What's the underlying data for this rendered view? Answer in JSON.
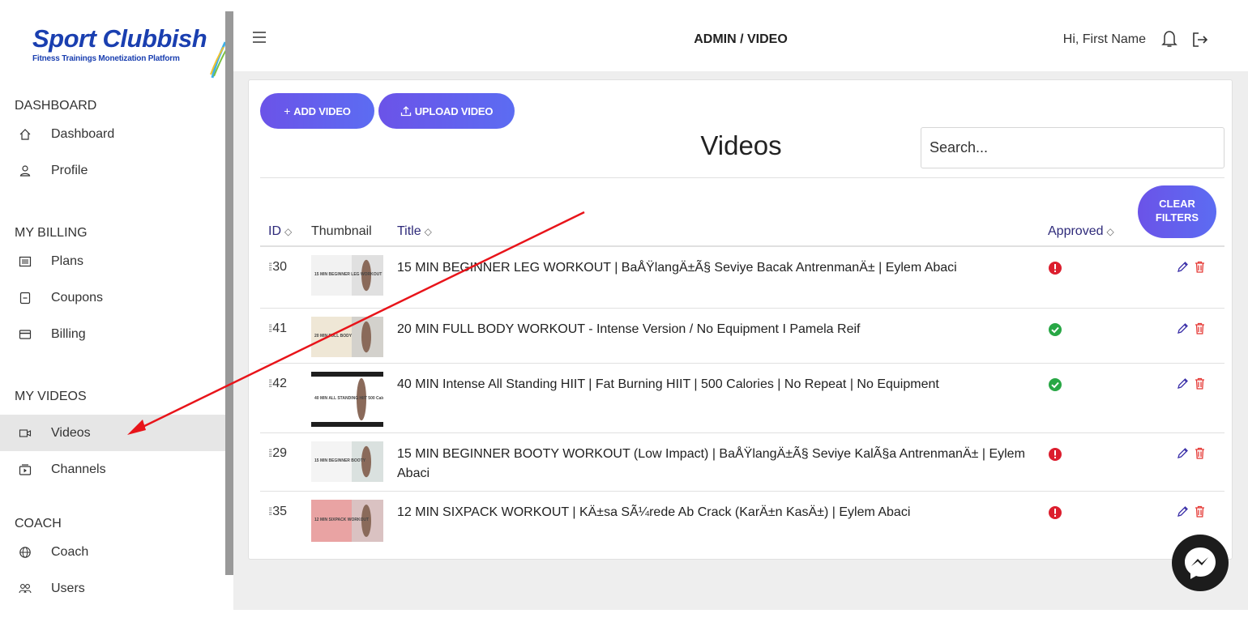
{
  "logo": {
    "title": "Sport Clubbish",
    "subtitle": "Fitness Trainings Monetization Platform"
  },
  "topbar": {
    "path": "ADMIN / VIDEO",
    "greeting": "Hi, First Name"
  },
  "sidebar": {
    "sections": [
      {
        "header": "DASHBOARD",
        "items": [
          {
            "label": "Dashboard",
            "icon": "home-icon"
          },
          {
            "label": "Profile",
            "icon": "user-icon"
          }
        ]
      },
      {
        "header": "MY BILLING",
        "items": [
          {
            "label": "Plans",
            "icon": "list-icon"
          },
          {
            "label": "Coupons",
            "icon": "coupon-icon"
          },
          {
            "label": "Billing",
            "icon": "card-icon"
          }
        ]
      },
      {
        "header": "MY VIDEOS",
        "items": [
          {
            "label": "Videos",
            "icon": "video-icon",
            "active": true
          },
          {
            "label": "Channels",
            "icon": "channel-icon"
          }
        ]
      },
      {
        "header": "COACH",
        "items": [
          {
            "label": "Coach",
            "icon": "globe-icon"
          },
          {
            "label": "Users",
            "icon": "users-icon"
          }
        ]
      }
    ]
  },
  "toolbar": {
    "add_label": "ADD VIDEO",
    "upload_label": "UPLOAD VIDEO",
    "clear_label_1": "CLEAR",
    "clear_label_2": "FILTERS"
  },
  "page": {
    "title": "Videos"
  },
  "search": {
    "placeholder": "Search..."
  },
  "table": {
    "columns": {
      "id": "ID",
      "thumbnail": "Thumbnail",
      "title": "Title",
      "approved": "Approved"
    },
    "rows": [
      {
        "id": "30",
        "title": "15 MIN BEGINNER LEG WORKOUT | BaÅŸlangÄ±Ã§ Seviye Bacak AntrenmanÄ± | Eylem Abaci",
        "approved": false,
        "thumb_text": "15 MIN BEGINNER LEG WORKOUT"
      },
      {
        "id": "41",
        "title": "20 MIN FULL BODY WORKOUT - Intense Version / No Equipment I Pamela Reif",
        "approved": true,
        "thumb_text": "20 MIN FULL BODY"
      },
      {
        "id": "42",
        "title": "40 MIN Intense All Standing HIIT | Fat Burning HIIT | 500 Calories | No Repeat | No Equipment",
        "approved": true,
        "thumb_text": "40 MIN ALL STANDING HIIT 500 Calories"
      },
      {
        "id": "29",
        "title": "15 MIN BEGINNER BOOTY WORKOUT (Low Impact) | BaÅŸlangÄ±Ã§ Seviye KalÃ§a AntrenmanÄ± | Eylem Abaci",
        "approved": false,
        "thumb_text": "15 MIN BEGINNER BOOTY"
      },
      {
        "id": "35",
        "title": "12 MIN SIXPACK WORKOUT | KÄ±sa SÃ¼rede Ab Crack (KarÄ±n KasÄ±) | Eylem Abaci",
        "approved": false,
        "thumb_text": "12 MIN SIXPACK WORKOUT"
      }
    ]
  },
  "colors": {
    "accent": "#6b53e8",
    "brand": "#1a3fb0",
    "approved": "#28a745",
    "rejected": "#dc1e2e",
    "delete": "#e53935"
  }
}
